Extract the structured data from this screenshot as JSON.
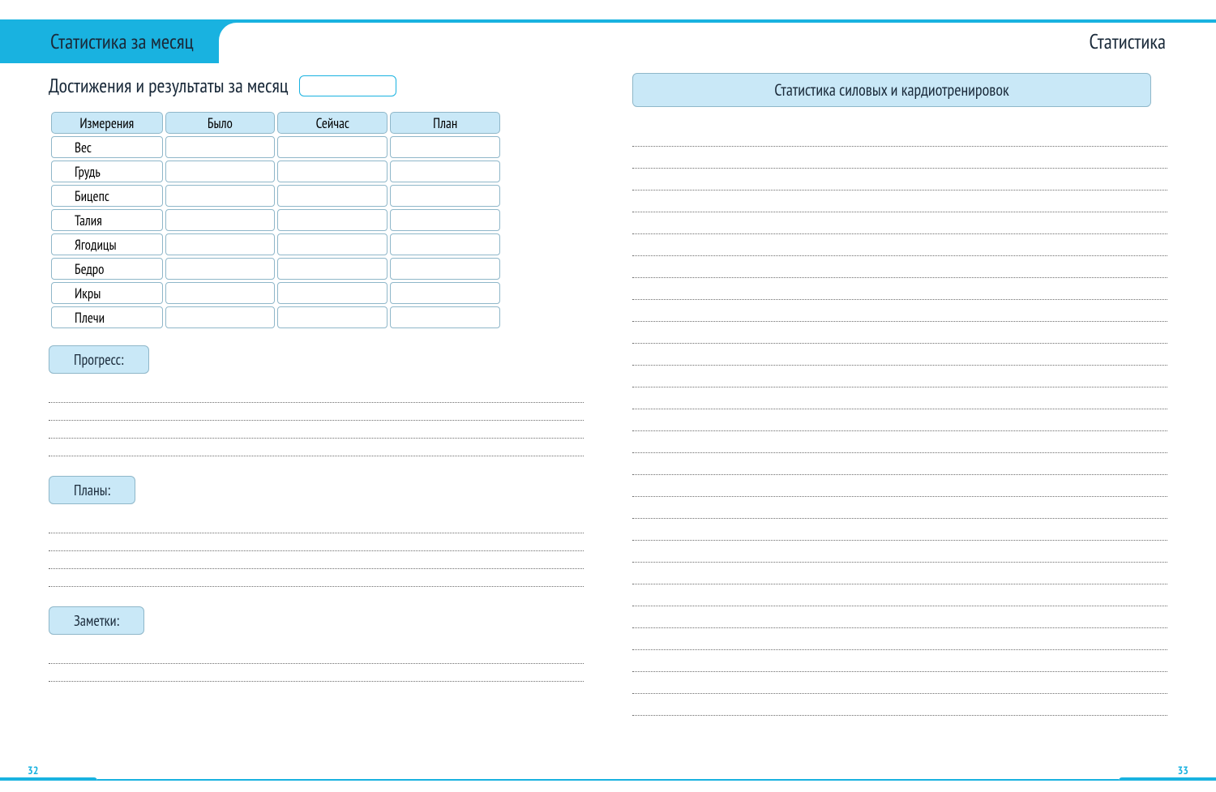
{
  "tabs": {
    "left": "Статистика за месяц",
    "right": "Статистика"
  },
  "page_numbers": {
    "left": "32",
    "right": "33"
  },
  "left_page": {
    "achievements_title": "Достижения и результаты за месяц",
    "month_value": "",
    "table": {
      "headers": [
        "Измерения",
        "Было",
        "Сейчас",
        "План"
      ],
      "rows": [
        {
          "label": "Вес",
          "was": "",
          "now": "",
          "plan": ""
        },
        {
          "label": "Грудь",
          "was": "",
          "now": "",
          "plan": ""
        },
        {
          "label": "Бицепс",
          "was": "",
          "now": "",
          "plan": ""
        },
        {
          "label": "Талия",
          "was": "",
          "now": "",
          "plan": ""
        },
        {
          "label": "Ягодицы",
          "was": "",
          "now": "",
          "plan": ""
        },
        {
          "label": "Бедро",
          "was": "",
          "now": "",
          "plan": ""
        },
        {
          "label": "Икры",
          "was": "",
          "now": "",
          "plan": ""
        },
        {
          "label": "Плечи",
          "was": "",
          "now": "",
          "plan": ""
        }
      ]
    },
    "sections": {
      "progress": {
        "label": "Прогресс:",
        "line_count": 4
      },
      "plans": {
        "label": "Планы:",
        "line_count": 4
      },
      "notes": {
        "label": "Заметки:",
        "line_count": 2
      }
    }
  },
  "right_page": {
    "header": "Статистика силовых и кардиотренировок",
    "line_count": 27
  }
}
